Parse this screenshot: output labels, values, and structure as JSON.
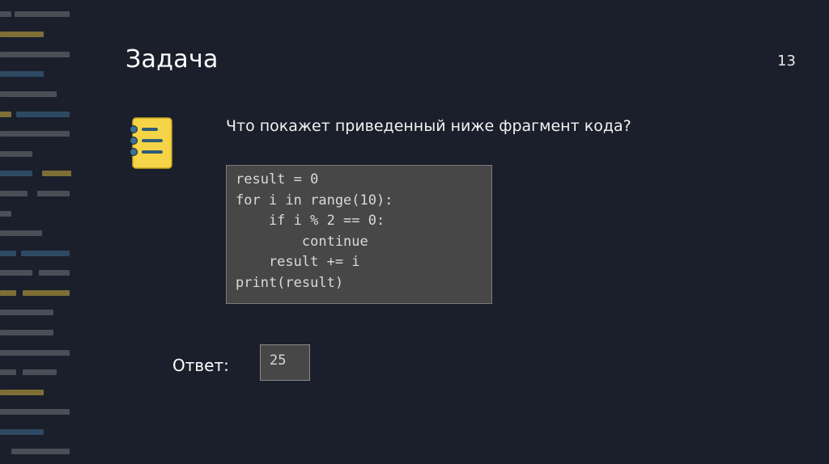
{
  "slide": {
    "title": "Задача",
    "page_number": "13",
    "question": "Что покажет приведенный ниже фрагмент кода?",
    "icon": "notepad-icon",
    "code_lines": [
      "result = 0",
      "for i in range(10):",
      "    if i % 2 == 0:",
      "        continue",
      "    result += i",
      "print(result)"
    ],
    "answer_label": "Ответ:",
    "answer_value": "25"
  },
  "colors": {
    "background": "#1b1f2b",
    "code_background": "#474747",
    "accent_yellow": "#f5d547",
    "accent_blue": "#3b6f96",
    "deco_gray": "#4a4e57",
    "deco_gold": "#8a7a3a"
  }
}
